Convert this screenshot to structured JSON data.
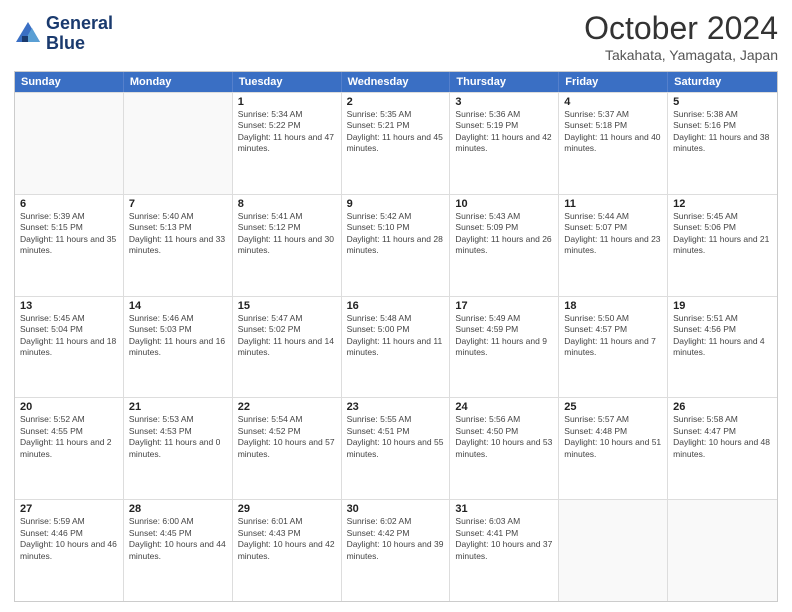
{
  "header": {
    "logo_line1": "General",
    "logo_line2": "Blue",
    "month_year": "October 2024",
    "location": "Takahata, Yamagata, Japan"
  },
  "days_of_week": [
    "Sunday",
    "Monday",
    "Tuesday",
    "Wednesday",
    "Thursday",
    "Friday",
    "Saturday"
  ],
  "weeks": [
    [
      {
        "day": "",
        "sunrise": "",
        "sunset": "",
        "daylight": ""
      },
      {
        "day": "",
        "sunrise": "",
        "sunset": "",
        "daylight": ""
      },
      {
        "day": "1",
        "sunrise": "Sunrise: 5:34 AM",
        "sunset": "Sunset: 5:22 PM",
        "daylight": "Daylight: 11 hours and 47 minutes."
      },
      {
        "day": "2",
        "sunrise": "Sunrise: 5:35 AM",
        "sunset": "Sunset: 5:21 PM",
        "daylight": "Daylight: 11 hours and 45 minutes."
      },
      {
        "day": "3",
        "sunrise": "Sunrise: 5:36 AM",
        "sunset": "Sunset: 5:19 PM",
        "daylight": "Daylight: 11 hours and 42 minutes."
      },
      {
        "day": "4",
        "sunrise": "Sunrise: 5:37 AM",
        "sunset": "Sunset: 5:18 PM",
        "daylight": "Daylight: 11 hours and 40 minutes."
      },
      {
        "day": "5",
        "sunrise": "Sunrise: 5:38 AM",
        "sunset": "Sunset: 5:16 PM",
        "daylight": "Daylight: 11 hours and 38 minutes."
      }
    ],
    [
      {
        "day": "6",
        "sunrise": "Sunrise: 5:39 AM",
        "sunset": "Sunset: 5:15 PM",
        "daylight": "Daylight: 11 hours and 35 minutes."
      },
      {
        "day": "7",
        "sunrise": "Sunrise: 5:40 AM",
        "sunset": "Sunset: 5:13 PM",
        "daylight": "Daylight: 11 hours and 33 minutes."
      },
      {
        "day": "8",
        "sunrise": "Sunrise: 5:41 AM",
        "sunset": "Sunset: 5:12 PM",
        "daylight": "Daylight: 11 hours and 30 minutes."
      },
      {
        "day": "9",
        "sunrise": "Sunrise: 5:42 AM",
        "sunset": "Sunset: 5:10 PM",
        "daylight": "Daylight: 11 hours and 28 minutes."
      },
      {
        "day": "10",
        "sunrise": "Sunrise: 5:43 AM",
        "sunset": "Sunset: 5:09 PM",
        "daylight": "Daylight: 11 hours and 26 minutes."
      },
      {
        "day": "11",
        "sunrise": "Sunrise: 5:44 AM",
        "sunset": "Sunset: 5:07 PM",
        "daylight": "Daylight: 11 hours and 23 minutes."
      },
      {
        "day": "12",
        "sunrise": "Sunrise: 5:45 AM",
        "sunset": "Sunset: 5:06 PM",
        "daylight": "Daylight: 11 hours and 21 minutes."
      }
    ],
    [
      {
        "day": "13",
        "sunrise": "Sunrise: 5:45 AM",
        "sunset": "Sunset: 5:04 PM",
        "daylight": "Daylight: 11 hours and 18 minutes."
      },
      {
        "day": "14",
        "sunrise": "Sunrise: 5:46 AM",
        "sunset": "Sunset: 5:03 PM",
        "daylight": "Daylight: 11 hours and 16 minutes."
      },
      {
        "day": "15",
        "sunrise": "Sunrise: 5:47 AM",
        "sunset": "Sunset: 5:02 PM",
        "daylight": "Daylight: 11 hours and 14 minutes."
      },
      {
        "day": "16",
        "sunrise": "Sunrise: 5:48 AM",
        "sunset": "Sunset: 5:00 PM",
        "daylight": "Daylight: 11 hours and 11 minutes."
      },
      {
        "day": "17",
        "sunrise": "Sunrise: 5:49 AM",
        "sunset": "Sunset: 4:59 PM",
        "daylight": "Daylight: 11 hours and 9 minutes."
      },
      {
        "day": "18",
        "sunrise": "Sunrise: 5:50 AM",
        "sunset": "Sunset: 4:57 PM",
        "daylight": "Daylight: 11 hours and 7 minutes."
      },
      {
        "day": "19",
        "sunrise": "Sunrise: 5:51 AM",
        "sunset": "Sunset: 4:56 PM",
        "daylight": "Daylight: 11 hours and 4 minutes."
      }
    ],
    [
      {
        "day": "20",
        "sunrise": "Sunrise: 5:52 AM",
        "sunset": "Sunset: 4:55 PM",
        "daylight": "Daylight: 11 hours and 2 minutes."
      },
      {
        "day": "21",
        "sunrise": "Sunrise: 5:53 AM",
        "sunset": "Sunset: 4:53 PM",
        "daylight": "Daylight: 11 hours and 0 minutes."
      },
      {
        "day": "22",
        "sunrise": "Sunrise: 5:54 AM",
        "sunset": "Sunset: 4:52 PM",
        "daylight": "Daylight: 10 hours and 57 minutes."
      },
      {
        "day": "23",
        "sunrise": "Sunrise: 5:55 AM",
        "sunset": "Sunset: 4:51 PM",
        "daylight": "Daylight: 10 hours and 55 minutes."
      },
      {
        "day": "24",
        "sunrise": "Sunrise: 5:56 AM",
        "sunset": "Sunset: 4:50 PM",
        "daylight": "Daylight: 10 hours and 53 minutes."
      },
      {
        "day": "25",
        "sunrise": "Sunrise: 5:57 AM",
        "sunset": "Sunset: 4:48 PM",
        "daylight": "Daylight: 10 hours and 51 minutes."
      },
      {
        "day": "26",
        "sunrise": "Sunrise: 5:58 AM",
        "sunset": "Sunset: 4:47 PM",
        "daylight": "Daylight: 10 hours and 48 minutes."
      }
    ],
    [
      {
        "day": "27",
        "sunrise": "Sunrise: 5:59 AM",
        "sunset": "Sunset: 4:46 PM",
        "daylight": "Daylight: 10 hours and 46 minutes."
      },
      {
        "day": "28",
        "sunrise": "Sunrise: 6:00 AM",
        "sunset": "Sunset: 4:45 PM",
        "daylight": "Daylight: 10 hours and 44 minutes."
      },
      {
        "day": "29",
        "sunrise": "Sunrise: 6:01 AM",
        "sunset": "Sunset: 4:43 PM",
        "daylight": "Daylight: 10 hours and 42 minutes."
      },
      {
        "day": "30",
        "sunrise": "Sunrise: 6:02 AM",
        "sunset": "Sunset: 4:42 PM",
        "daylight": "Daylight: 10 hours and 39 minutes."
      },
      {
        "day": "31",
        "sunrise": "Sunrise: 6:03 AM",
        "sunset": "Sunset: 4:41 PM",
        "daylight": "Daylight: 10 hours and 37 minutes."
      },
      {
        "day": "",
        "sunrise": "",
        "sunset": "",
        "daylight": ""
      },
      {
        "day": "",
        "sunrise": "",
        "sunset": "",
        "daylight": ""
      }
    ]
  ]
}
